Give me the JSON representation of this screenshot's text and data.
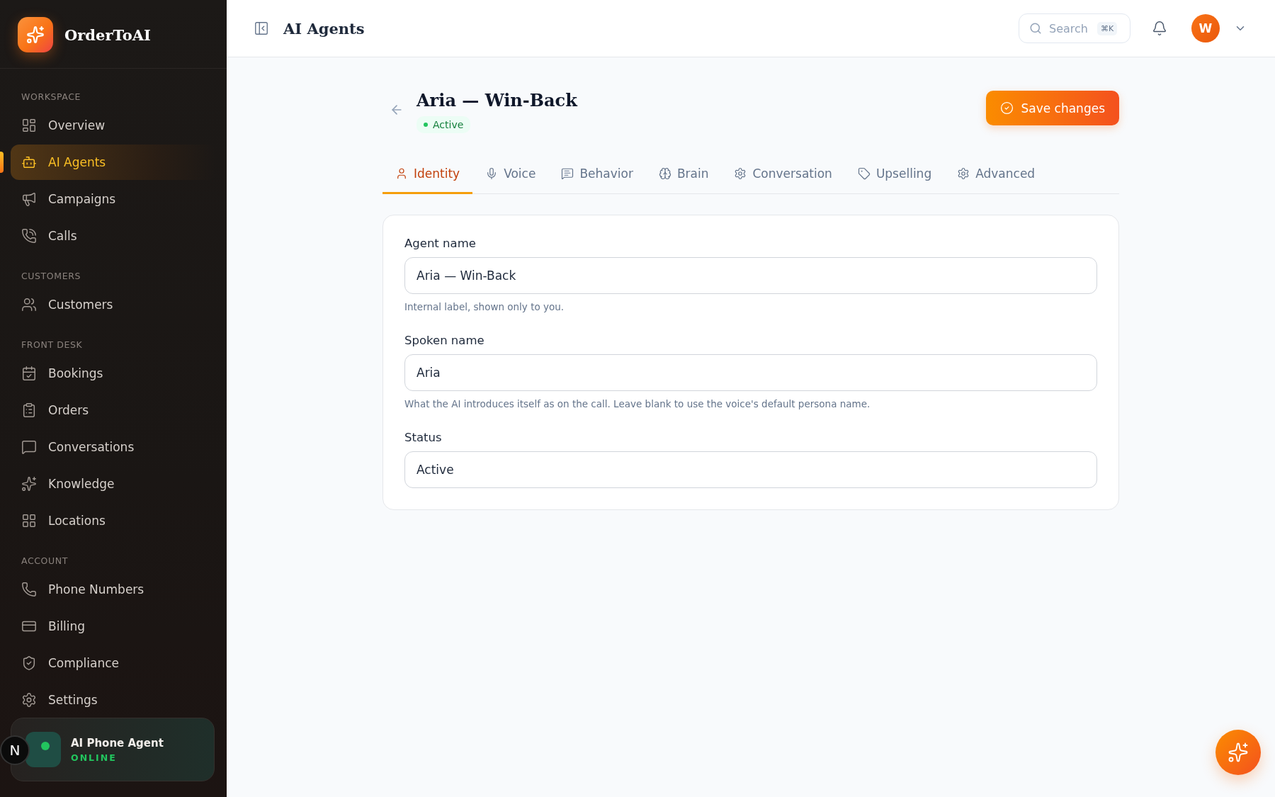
{
  "brand": {
    "name": "OrderToAI"
  },
  "sidebar": {
    "sections": [
      {
        "heading": "WORKSPACE",
        "items": [
          {
            "label": "Overview",
            "selected": false
          },
          {
            "label": "AI Agents",
            "selected": true
          },
          {
            "label": "Campaigns",
            "selected": false
          },
          {
            "label": "Calls",
            "selected": false
          }
        ]
      },
      {
        "heading": "CUSTOMERS",
        "items": [
          {
            "label": "Customers",
            "selected": false
          }
        ]
      },
      {
        "heading": "FRONT DESK",
        "items": [
          {
            "label": "Bookings",
            "selected": false
          },
          {
            "label": "Orders",
            "selected": false
          },
          {
            "label": "Conversations",
            "selected": false
          },
          {
            "label": "Knowledge",
            "selected": false
          },
          {
            "label": "Locations",
            "selected": false
          }
        ]
      },
      {
        "heading": "ACCOUNT",
        "items": [
          {
            "label": "Phone Numbers",
            "selected": false
          },
          {
            "label": "Billing",
            "selected": false
          },
          {
            "label": "Compliance",
            "selected": false
          },
          {
            "label": "Settings",
            "selected": false
          }
        ]
      }
    ]
  },
  "agent_card": {
    "title": "AI Phone Agent",
    "status": "ONLINE",
    "badge": "N"
  },
  "header": {
    "title": "AI Agents",
    "search": {
      "placeholder": "Search",
      "shortcut": "⌘K"
    },
    "avatar": "W"
  },
  "page": {
    "title": "Aria — Win-Back",
    "status": "Active",
    "save_button": "Save changes"
  },
  "tabs": [
    {
      "label": "Identity",
      "selected": true
    },
    {
      "label": "Voice",
      "selected": false
    },
    {
      "label": "Behavior",
      "selected": false
    },
    {
      "label": "Brain",
      "selected": false
    },
    {
      "label": "Conversation",
      "selected": false
    },
    {
      "label": "Upselling",
      "selected": false
    },
    {
      "label": "Advanced",
      "selected": false
    }
  ],
  "form": {
    "fields": [
      {
        "label": "Agent name",
        "value": "Aria — Win-Back",
        "help": "Internal label, shown only to you."
      },
      {
        "label": "Spoken name",
        "value": "Aria",
        "help": "What the AI introduces itself as on the call. Leave blank to use the voice's default persona name."
      },
      {
        "label": "Status",
        "value": "Active"
      }
    ]
  }
}
